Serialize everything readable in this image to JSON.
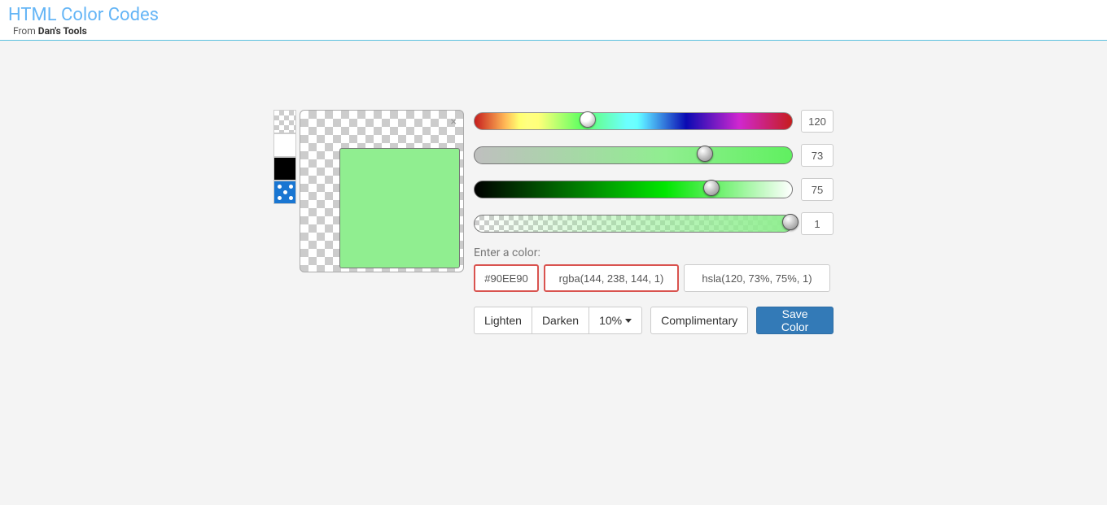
{
  "header": {
    "title": "HTML Color Codes",
    "from": "From ",
    "brand": "Dan's Tools"
  },
  "preview_color": "#90EE90",
  "sliders": {
    "hue_value": "120",
    "hue_pos": "33%",
    "sat_value": "73",
    "sat_pos": "70%",
    "light_value": "75",
    "light_pos": "72%",
    "alpha_value": "1",
    "alpha_pos": "97%"
  },
  "enter_label": "Enter a color:",
  "inputs": {
    "hex": "#90EE90",
    "rgba": "rgba(144, 238, 144, 1)",
    "hsla": "hsla(120, 73%, 75%, 1)"
  },
  "buttons": {
    "lighten": "Lighten",
    "darken": "Darken",
    "pct": "10% ",
    "complimentary": "Complimentary",
    "save": "Save Color"
  }
}
